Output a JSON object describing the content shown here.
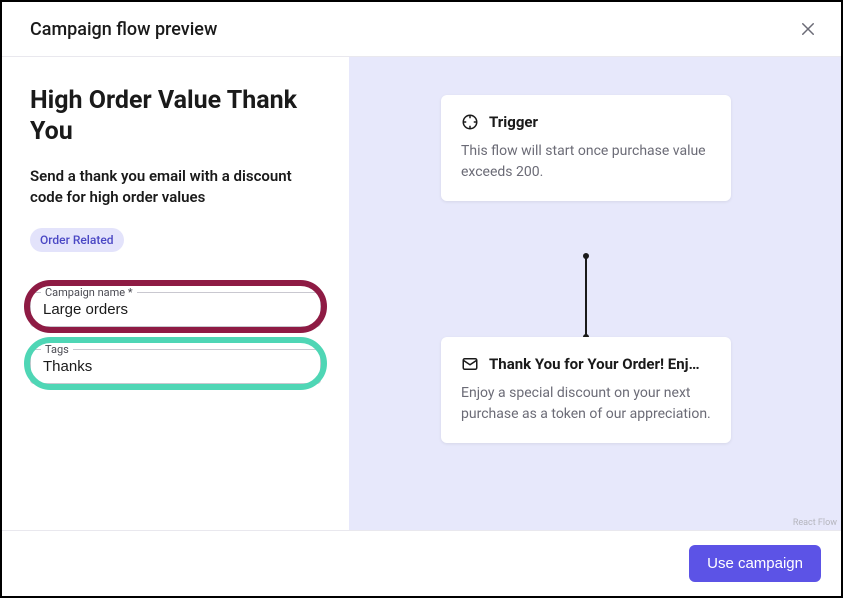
{
  "header": {
    "title": "Campaign flow preview"
  },
  "left": {
    "title": "High Order Value Thank You",
    "description": "Send a thank you email with a discount code for high order values",
    "chip": "Order Related",
    "campaign_name": {
      "label": "Campaign name *",
      "value": "Large orders"
    },
    "tags": {
      "label": "Tags",
      "value": "Thanks"
    }
  },
  "flow": {
    "trigger": {
      "title": "Trigger",
      "body": "This flow will start once purchase value exceeds 200."
    },
    "email": {
      "title": "Thank You for Your Order! Enj…",
      "body": "Enjoy a special discount on your next purchase as a token of our appreciation."
    },
    "attribution": "React Flow"
  },
  "footer": {
    "use_campaign": "Use campaign"
  }
}
